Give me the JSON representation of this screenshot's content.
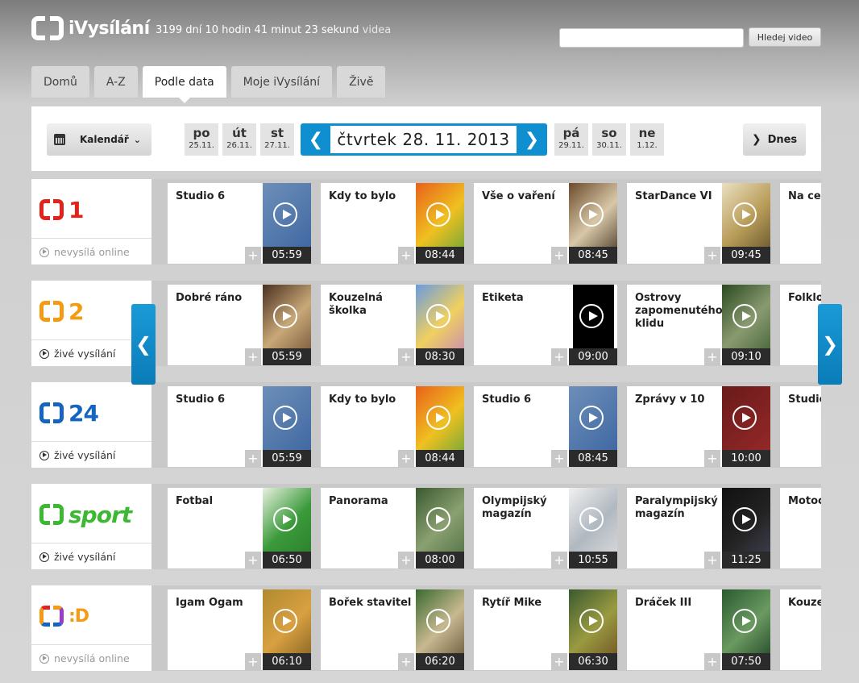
{
  "header": {
    "logo_text": "iVysílání",
    "counter_text": "3199 dní 10 hodin 41 minut 23 sekund",
    "counter_suffix": "videa",
    "search_button": "Hledej video"
  },
  "tabs": [
    {
      "label": "Domů"
    },
    {
      "label": "A-Z"
    },
    {
      "label": "Podle data",
      "active": true
    },
    {
      "label": "Moje iVysílání"
    },
    {
      "label": "Živě"
    }
  ],
  "datebar": {
    "calendar_label": "Kalendář",
    "days_before": [
      {
        "name": "po",
        "date": "25.11."
      },
      {
        "name": "út",
        "date": "26.11."
      },
      {
        "name": "st",
        "date": "27.11."
      }
    ],
    "current": "čtvrtek 28. 11. 2013",
    "days_after": [
      {
        "name": "pá",
        "date": "29.11."
      },
      {
        "name": "so",
        "date": "30.11."
      },
      {
        "name": "ne",
        "date": "1.12."
      }
    ],
    "today_label": "Dnes"
  },
  "colors": {
    "accent": "#0f8ed0",
    "ct1": "#e0231b",
    "ct2": "#f39b13",
    "ct24": "#1565c0",
    "sport": "#3cb832"
  },
  "channels": [
    {
      "logo": "1",
      "status": "nevysílá online",
      "status_type": "off",
      "programs": [
        {
          "title": "Studio 6",
          "time": "05:59"
        },
        {
          "title": "Kdy to bylo",
          "time": "08:44"
        },
        {
          "title": "Vše o vaření",
          "time": "08:45"
        },
        {
          "title": "StarDance VI",
          "time": "09:45"
        },
        {
          "title": "Na ces",
          "time": ""
        }
      ]
    },
    {
      "logo": "2",
      "status": "živé vysílání",
      "status_type": "live",
      "programs": [
        {
          "title": "Dobré ráno",
          "time": "05:59"
        },
        {
          "title": "Kouzelná školka",
          "time": "08:30"
        },
        {
          "title": "Etiketa",
          "time": "09:00"
        },
        {
          "title": "Ostrovy zapomenutého klidu",
          "time": "09:10"
        },
        {
          "title": "Folklo",
          "time": ""
        }
      ]
    },
    {
      "logo": "24",
      "status": "živé vysílání",
      "status_type": "live",
      "programs": [
        {
          "title": "Studio 6",
          "time": "05:59"
        },
        {
          "title": "Kdy to bylo",
          "time": "08:44"
        },
        {
          "title": "Studio 6",
          "time": "08:45"
        },
        {
          "title": "Zprávy v 10",
          "time": "10:00"
        },
        {
          "title": "Studio",
          "time": ""
        }
      ]
    },
    {
      "logo": "sport",
      "status": "živé vysílání",
      "status_type": "live",
      "programs": [
        {
          "title": "Fotbal",
          "time": "06:50"
        },
        {
          "title": "Panorama",
          "time": "08:00"
        },
        {
          "title": "Olympijský magazín",
          "time": "10:55"
        },
        {
          "title": "Paralympijský magazín",
          "time": "11:25"
        },
        {
          "title": "Motoc závod",
          "time": ""
        }
      ]
    },
    {
      "logo": ":D",
      "status": "nevysílá online",
      "status_type": "off",
      "programs": [
        {
          "title": "Igam Ogam",
          "time": "06:10"
        },
        {
          "title": "Bořek stavitel",
          "time": "06:20"
        },
        {
          "title": "Rytíř Mike",
          "time": "06:30"
        },
        {
          "title": "Dráček III",
          "time": "07:50"
        },
        {
          "title": "Kouze školka",
          "time": ""
        }
      ]
    }
  ]
}
